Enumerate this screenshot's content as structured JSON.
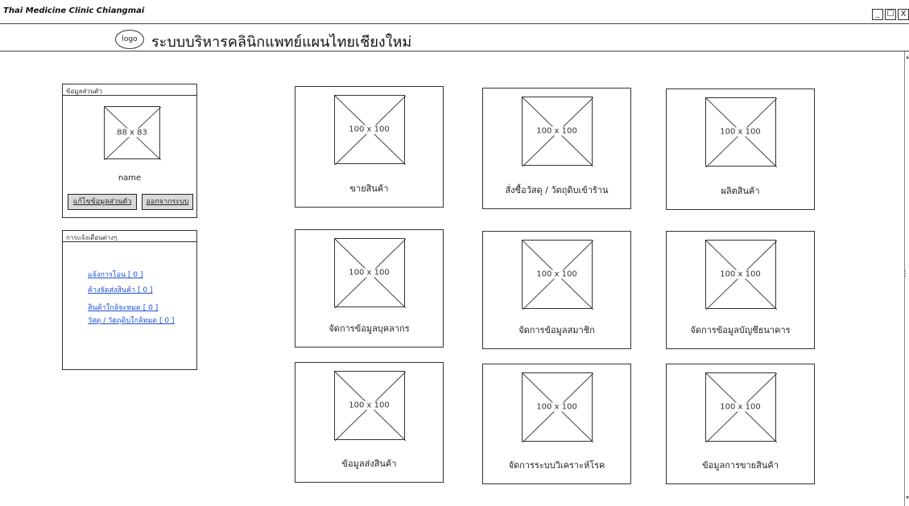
{
  "window": {
    "title": "Thai Medicine Clinic Chiangmai",
    "controls": [
      "_",
      "☐",
      "X"
    ]
  },
  "header": {
    "logo_text": "logo",
    "title": "ระบบบริหารคลินิกแพทย์แผนไทยเชียงใหม่"
  },
  "profile": {
    "header": "ข้อมูลส่วนตัว",
    "avatar_label": "88 x 83",
    "name": "name",
    "edit_button": "แก้ไขข้อมูลส่วนตัว",
    "logout_button": "ออกจากระบบ"
  },
  "notifications": {
    "header": "การแจ้งเตือนต่างๆ",
    "items": [
      "แจ้งการโอน [ 0 ]",
      "ค้างจัดส่งสินค้า [ 0 ]",
      "สินค้าใกล้จะหมด [ 0 ]",
      "วัสดุ / วัตถุดิบใกล้หมด [ 0 ]"
    ]
  },
  "menu": {
    "image_label": "100 x 100",
    "cards": [
      "ขายสินค้า",
      "สั่งซื้อวัสดุ / วัตถุดิบเข้าร้าน",
      "ผลิตสินค้า",
      "จัดการข้อมูลบุคลากร",
      "จัดการข้อมูลสมาชิก",
      "จัดการข้อมูลบัญชีธนาคาร",
      "ข้อมูลส่งสินค้า",
      "จัดการระบบวิเคราะห์โรค",
      "ข้อมูลการขายสินค้า"
    ]
  }
}
